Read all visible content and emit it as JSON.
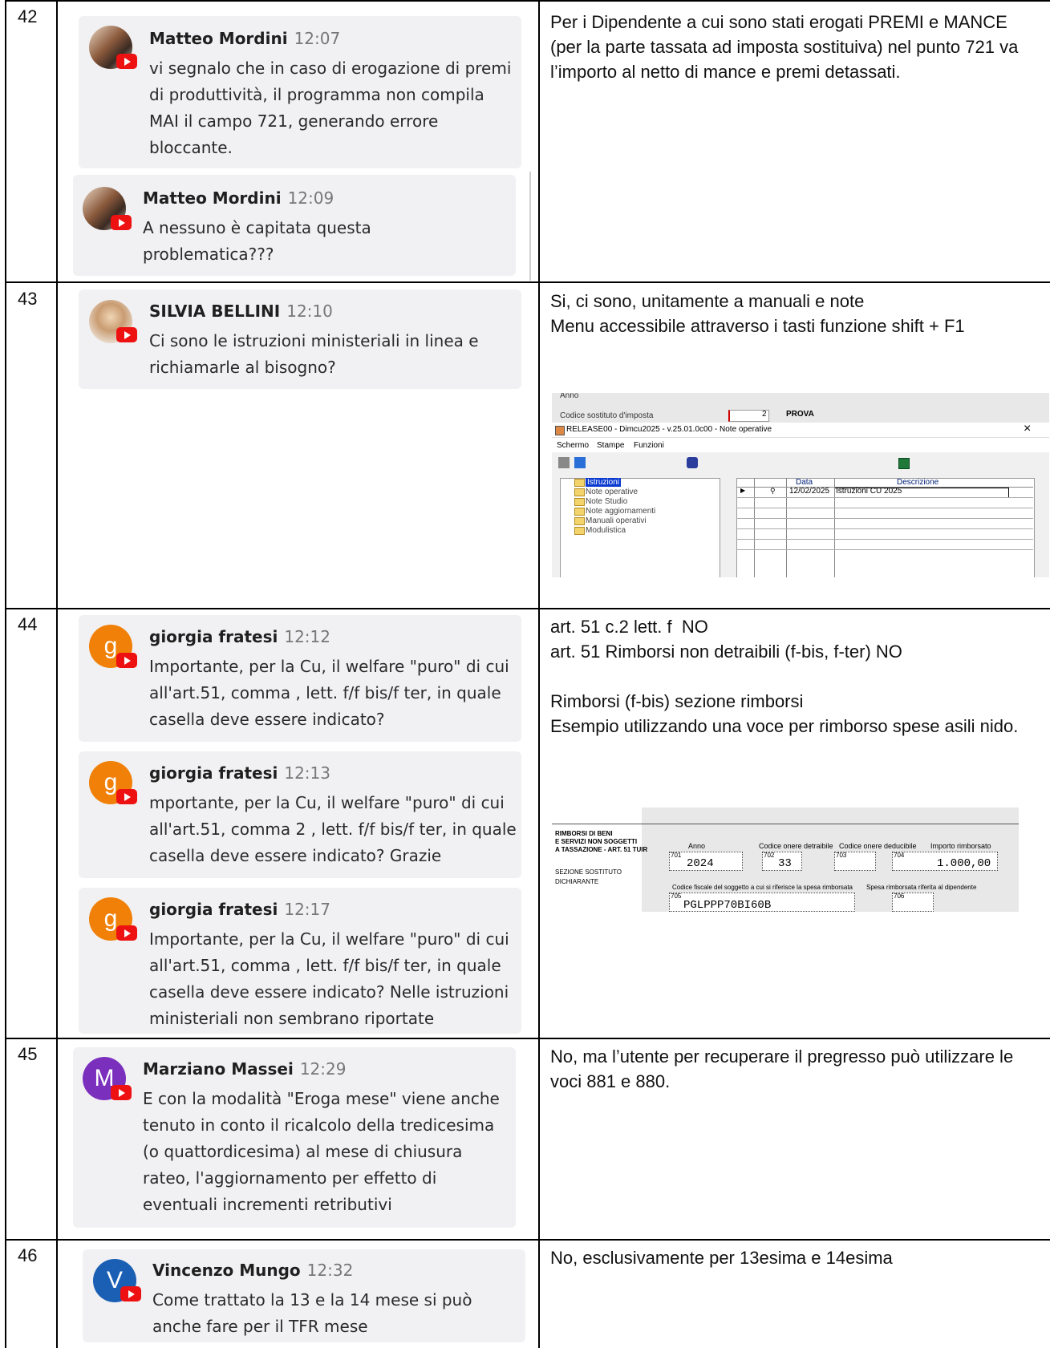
{
  "rows": [
    {
      "number": "42",
      "messages": [
        {
          "name": "Matteo Mordini",
          "time": "12:07",
          "text": "vi segnalo che in caso di erogazione di premi di produttività, il programma non compila MAI il campo 721, generando errore bloccante."
        },
        {
          "name": "Matteo Mordini",
          "time": "12:09",
          "text": "A nessuno è capitata questa problematica???"
        }
      ],
      "answer": [
        "Per i Dipendente a cui sono stati erogati PREMI e MANCE (per la parte tassata ad imposta sostituiva) nel punto 721 va l’importo al netto di mance e premi detassati."
      ]
    },
    {
      "number": "43",
      "messages": [
        {
          "name": "SILVIA BELLINI",
          "time": "12:10",
          "text": "Ci sono le istruzioni ministeriali in linea e richiamarle al bisogno?"
        }
      ],
      "answer": [
        "Si, ci sono, unitamente a manuali e note",
        "Menu accessibile attraverso i tasti funzione shift + F1"
      ]
    },
    {
      "number": "44",
      "messages": [
        {
          "name": "giorgia fratesi",
          "time": "12:12",
          "avatar_letter": "g",
          "text": "Importante, per la Cu, il welfare \"puro\" di cui all'art.51, comma , lett. f/f bis/f ter, in quale casella deve essere indicato?"
        },
        {
          "name": "giorgia fratesi",
          "time": "12:13",
          "avatar_letter": "g",
          "text": "mportante, per la Cu, il welfare \"puro\" di cui all'art.51, comma 2 , lett. f/f bis/f ter, in quale casella deve essere indicato? Grazie"
        },
        {
          "name": "giorgia fratesi",
          "time": "12:17",
          "avatar_letter": "g",
          "text": "Importante, per la Cu, il welfare \"puro\" di cui all'art.51, comma , lett. f/f bis/f ter, in quale casella deve essere indicato? Nelle istruzioni ministeriali non sembrano riportate"
        }
      ],
      "answer": [
        "art. 51 c.2 lett. f  NO",
        "art. 51 Rimborsi non detraibili (f-bis, f-ter) NO",
        "",
        "Rimborsi (f-bis) sezione rimborsi",
        "Esempio utilizzando una voce per rimborso spese asili nido."
      ]
    },
    {
      "number": "45",
      "messages": [
        {
          "name": "Marziano Massei",
          "time": "12:29",
          "avatar_letter": "M",
          "text": "E con la modalità \"Eroga mese\" viene anche tenuto in conto il ricalcolo della tredicesima (o quattordicesima) al mese di chiusura rateo, l'aggiornamento per effetto di eventuali incrementi retributivi"
        }
      ],
      "answer": [
        "No, ma l’utente per recuperare il pregresso può utilizzare le voci 881 e 880."
      ]
    },
    {
      "number": "46",
      "messages": [
        {
          "name": "Vincenzo Mungo",
          "time": "12:32",
          "avatar_letter": "V",
          "text": "Come trattato la 13 e la 14 mese si può anche fare per il TFR mese"
        }
      ],
      "answer": [
        "No, esclusivamente per 13esima e 14esima"
      ]
    }
  ],
  "screenshot_notes": {
    "behind_anno": "Anno",
    "behind_codice": "Codice sostituto d'imposta",
    "behind_value": "2",
    "behind_prova": "PROVA",
    "window_title": "RELEASE00 - Dimcu2025 - v.25.01.0c00 - Note operative",
    "menu": [
      "Schermo",
      "Stampe",
      "Funzioni"
    ],
    "tree": [
      "Istruzioni",
      "Note operative",
      "Note Studio",
      "Note aggiornamenti",
      "Manuali operativi",
      "Modulistica"
    ],
    "grid_headers": [
      "Data",
      "Descrizione"
    ],
    "grid_row": {
      "date": "12/02/2025",
      "desc": "Istruzioni CU 2025"
    },
    "close": "×"
  },
  "screenshot_form": {
    "section_title": [
      "RIMBORSI DI BENI",
      "E SERVIZI NON SOGGETTI",
      "A TASSAZIONE - ART. 51 TUIR"
    ],
    "section_sub": [
      "SEZIONE SOSTITUTO",
      "DICHIARANTE"
    ],
    "headers": [
      "Anno",
      "Codice onere detraibile",
      "Codice onere deducibile",
      "Importo rimborsato"
    ],
    "codes": [
      "701",
      "702",
      "703",
      "704",
      "705",
      "706"
    ],
    "values": {
      "anno": "2024",
      "onere": "33",
      "importo": "1.000,00",
      "cf": "PGLPPP70BI60B"
    },
    "labels2": [
      "Codice fiscale del soggetto a cui si riferisce la spesa rimborsata",
      "Spesa rimborsata riferita al dipendente"
    ]
  }
}
